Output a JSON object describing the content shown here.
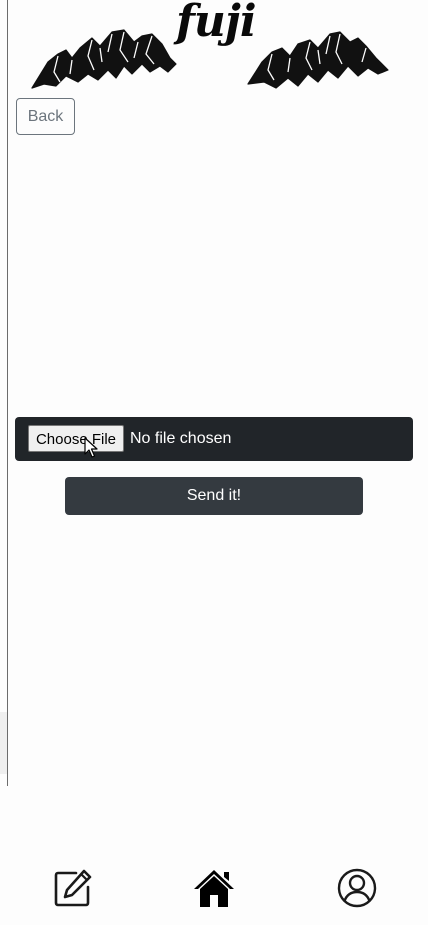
{
  "header": {
    "logo_text": "fuji",
    "logo_icon": "mountains-icon"
  },
  "actions": {
    "back_label": "Back"
  },
  "upload": {
    "choose_label": "Choose File",
    "status_text": "No file chosen",
    "submit_label": "Send it!"
  },
  "bottom_nav": {
    "items": [
      {
        "icon": "edit-icon",
        "label": "Edit"
      },
      {
        "icon": "home-icon",
        "label": "Home"
      },
      {
        "icon": "profile-icon",
        "label": "Profile"
      }
    ]
  },
  "colors": {
    "page_bg": "#fdfdfd",
    "file_bar_bg": "#212529",
    "send_button_bg": "#343a40",
    "back_button_border": "#6c757d"
  }
}
